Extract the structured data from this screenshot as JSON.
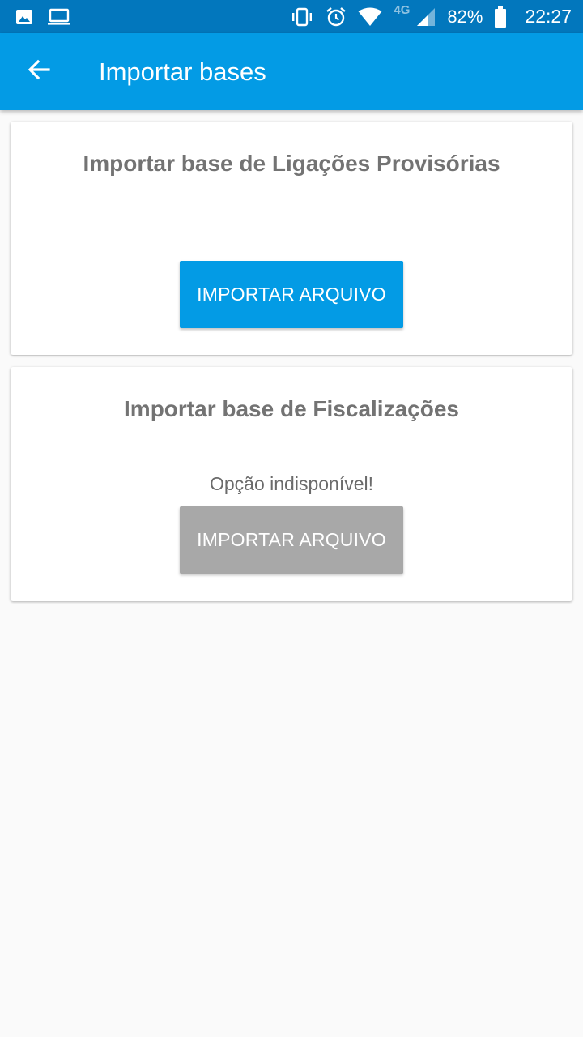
{
  "status_bar": {
    "icons_left": [
      "image-icon",
      "laptop-icon"
    ],
    "icons_right": [
      "vibrate-icon",
      "alarm-icon",
      "wifi-icon",
      "signal-icon",
      "battery-icon"
    ],
    "network_label": "4G",
    "battery_percent": "82%",
    "clock": "22:27"
  },
  "app_bar": {
    "title": "Importar bases",
    "back_icon": "arrow-back-icon",
    "color": "#039be5"
  },
  "cards": [
    {
      "title": "Importar base de Ligações Provisórias",
      "note": "",
      "button_label": "IMPORTAR ARQUIVO",
      "button_enabled": true,
      "button_color": "#039be5"
    },
    {
      "title": "Importar base de Fiscalizações",
      "note": "Opção indisponível!",
      "button_label": "IMPORTAR ARQUIVO",
      "button_enabled": false,
      "button_color": "#a8a8a8"
    }
  ]
}
